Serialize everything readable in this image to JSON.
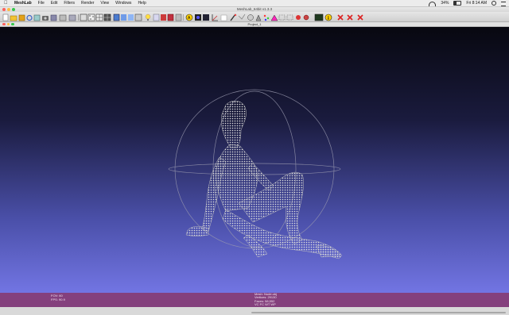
{
  "menubar": {
    "items": [
      "MeshLab",
      "File",
      "Edit",
      "Filters",
      "Render",
      "View",
      "Windows",
      "Help"
    ],
    "battery": "34%",
    "clock": "Fri 8:14 AM"
  },
  "window": {
    "title": "MeshLab_64bit v1.3.3"
  },
  "project": {
    "title": "Project_1"
  },
  "toolbar_icons": [
    "new-icon",
    "open-icon",
    "save-icon",
    "reload-icon",
    "export-icon",
    "snapshot-icon",
    "copy-icon",
    "bbox-icon",
    "points-icon",
    "wireframe-icon",
    "hidden-lines-icon",
    "flat-lines-icon",
    "flat-icon",
    "smooth-icon",
    "texture-icon",
    "light-icon",
    "two-sided-light-icon",
    "fancy-light-icon",
    "color-icon",
    "texture-mode-icon",
    "annotate-icon",
    "a-info-icon",
    "shader-icon",
    "measure-icon",
    "select-icon",
    "paint-icon",
    "align-icon",
    "pick-points-icon",
    "quality-map-icon",
    "edit-tool-icon",
    "select-faces-icon",
    "select-vertices-icon",
    "z-paint-icon",
    "sculpt-icon",
    "dark-screen-icon",
    "info-icon",
    "delete-selection-icon",
    "delete-faces-icon",
    "delete-vertices-icon"
  ],
  "info": {
    "fov": "FOV: 60",
    "fps": "FPS:   90.9",
    "mesh": "Mesh: Nude.obj",
    "vertices": "Vertices: 29130",
    "faces": "Faces: 58,552",
    "flags": "VC FC WT WP"
  },
  "colors": {
    "info_bar": "#84407d",
    "viewport_top": "#080810",
    "viewport_bottom": "#7275e3",
    "mesh": "#d8d8d8"
  }
}
